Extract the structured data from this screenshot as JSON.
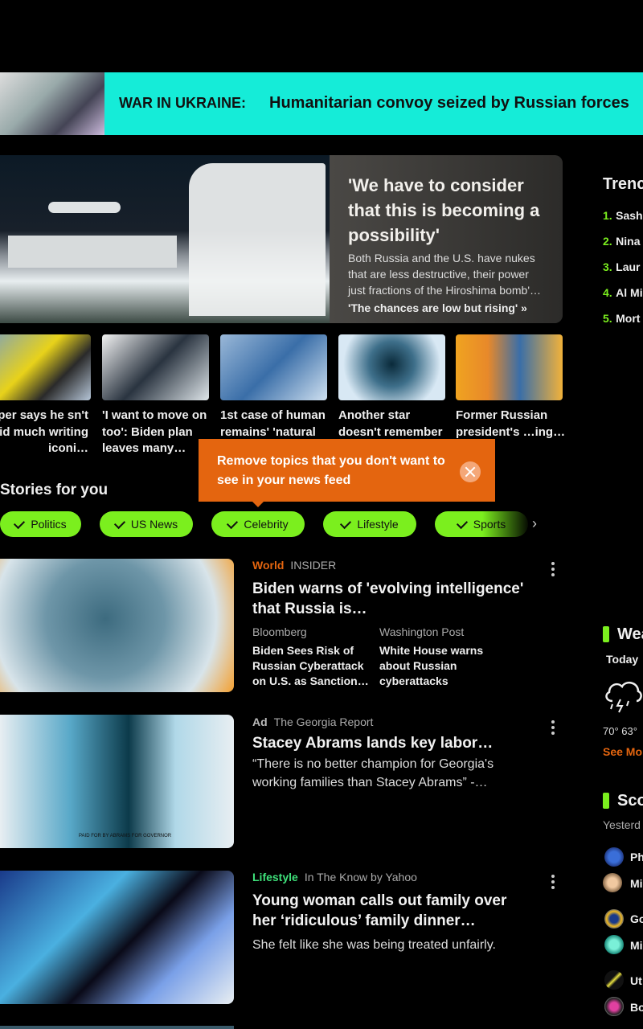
{
  "banner": {
    "tag": "WAR IN UKRAINE:",
    "headline": "Humanitarian convoy seized by Russian forces"
  },
  "hero": {
    "title": "'We have to consider that this is becoming a possibility'",
    "description": "Both Russia and the U.S. have nukes that are less destructive, their power just fractions of the Hiroshima bomb'…",
    "link": "'The chances are low but rising' »"
  },
  "thumbs": [
    {
      "caption": "pper says he sn't paid much writing iconi…"
    },
    {
      "caption": "'I want to move on too': Biden plan leaves many…"
    },
    {
      "caption": "1st case of human remains' 'natural"
    },
    {
      "caption": "Another star doesn't remember"
    },
    {
      "caption": "Former Russian president's …ing…"
    }
  ],
  "tooltip": {
    "text": "Remove topics that you don't want to see in your news feed"
  },
  "stories_title": "Stories for you",
  "chips": [
    "Politics",
    "US News",
    "Celebrity",
    "Lifestyle",
    "Sports"
  ],
  "chips_next": "›",
  "feed": [
    {
      "category": "World",
      "source": "INSIDER",
      "title": "Biden warns of 'evolving intelligence' that Russia is…",
      "related": [
        {
          "source": "Bloomberg",
          "title": "Biden Sees Risk of Russian Cyberattack on U.S. as Sanction…"
        },
        {
          "source": "Washington Post",
          "title": "White House warns about Russian cyberattacks"
        }
      ]
    },
    {
      "category": "Ad",
      "source": "The Georgia Report",
      "title": "Stacey Abrams lands key labor…",
      "description": "“There is no better champion for Georgia's working families than Stacey Abrams” -…",
      "image_caption": "PAID FOR BY ABRAMS FOR GOVERNOR"
    },
    {
      "category": "Lifestyle",
      "source": "In The Know by Yahoo",
      "title": "Young woman calls out family over her ‘ridiculous’ family dinner…",
      "description": "She felt like she was being treated unfairly."
    }
  ],
  "rail": {
    "trending_title": "Trenc",
    "trending": [
      {
        "n": "1.",
        "name": "Sash"
      },
      {
        "n": "2.",
        "name": "Nina"
      },
      {
        "n": "3.",
        "name": "Laur"
      },
      {
        "n": "4.",
        "name": "Al Mi"
      },
      {
        "n": "5.",
        "name": "Mort"
      }
    ],
    "weather_title": "Wea",
    "weather_day": "Today",
    "weather_temps": "70°  63°",
    "weather_more": "See Mo",
    "scores_title": "Sco",
    "scores_day": "Yesterd",
    "teams": [
      "Ph",
      "Mi",
      "Go",
      "Mi",
      "Ut",
      "Bo"
    ]
  },
  "colors": {
    "accent_green": "#7bef1e",
    "banner": "#15ecd8",
    "tooltip": "#e4650f",
    "world": "#e4650f",
    "lifestyle": "#3ee07a"
  }
}
